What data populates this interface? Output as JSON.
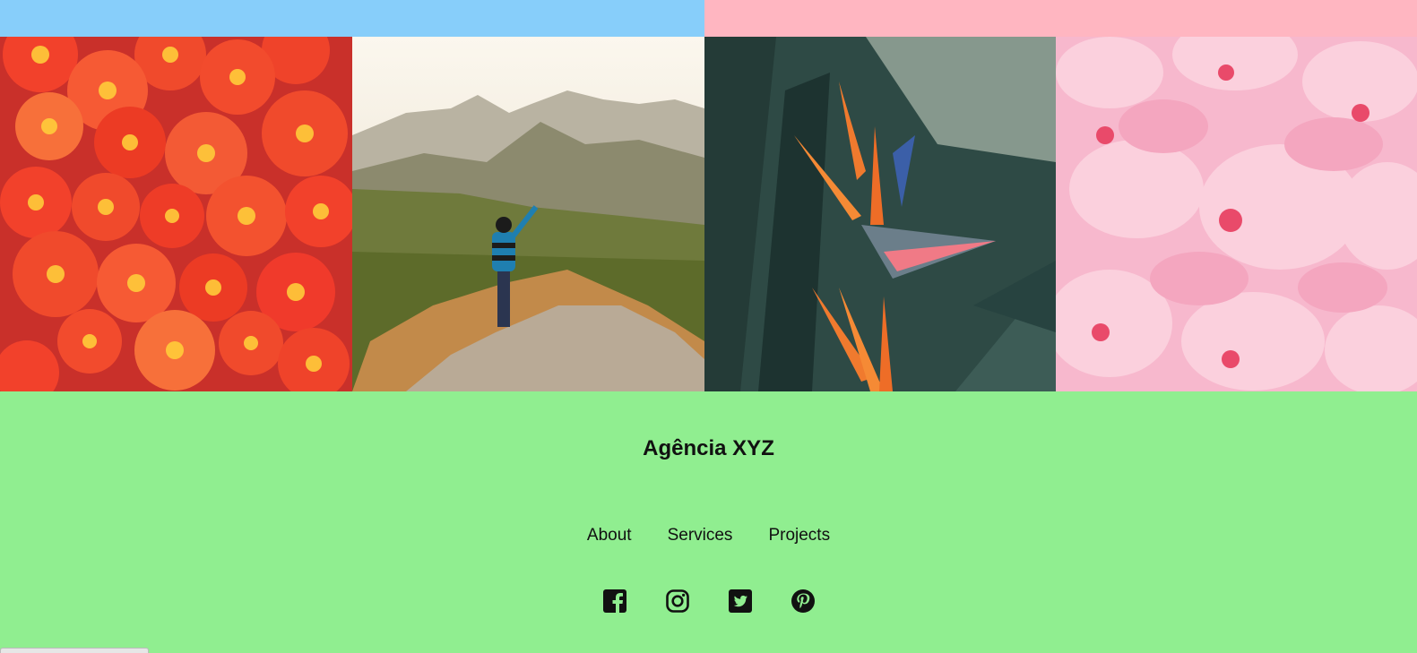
{
  "colors": {
    "top_bar_left": "#87cefa",
    "top_bar_right": "#ffb6c1",
    "footer_bg": "#90ee90",
    "text": "#111111"
  },
  "gallery": {
    "images": [
      {
        "alt": "tomatoes"
      },
      {
        "alt": "person on mountain top"
      },
      {
        "alt": "bird of paradise flower"
      },
      {
        "alt": "pink flowers"
      }
    ]
  },
  "footer": {
    "brand": "Agência XYZ",
    "nav": [
      {
        "label": "About"
      },
      {
        "label": "Services"
      },
      {
        "label": "Projects"
      }
    ],
    "social": [
      {
        "icon": "facebook-icon"
      },
      {
        "icon": "instagram-icon"
      },
      {
        "icon": "twitter-icon"
      },
      {
        "icon": "pinterest-icon"
      }
    ]
  }
}
